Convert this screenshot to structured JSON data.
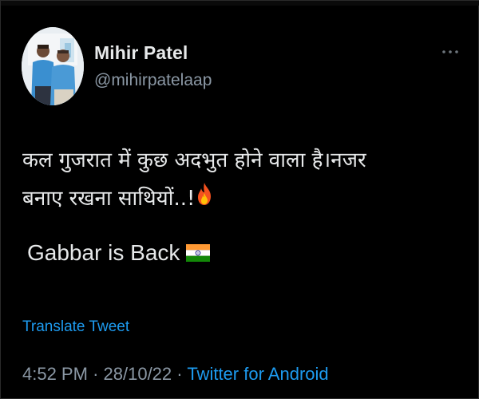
{
  "author": {
    "name": "Mihir Patel",
    "handle": "@mihirpatelaap"
  },
  "tweet": {
    "text_line1": "कल गुजरात में कुछ अदभुत होने वाला है।नजर",
    "text_line2": "बनाए रखना साथियों..!",
    "line3": "Gabbar is Back",
    "emoji_1": "fire-emoji",
    "emoji_2": "india-flag-emoji"
  },
  "actions": {
    "translate_label": "Translate Tweet",
    "more_icon": "more-horizontal-icon"
  },
  "meta": {
    "time": "4:52 PM",
    "separator": "·",
    "date": "28/10/22",
    "source": "Twitter for Android"
  },
  "colors": {
    "background": "#000000",
    "text_primary": "#e7e9ea",
    "text_secondary": "#8b98a5",
    "link": "#1d9bf0"
  }
}
